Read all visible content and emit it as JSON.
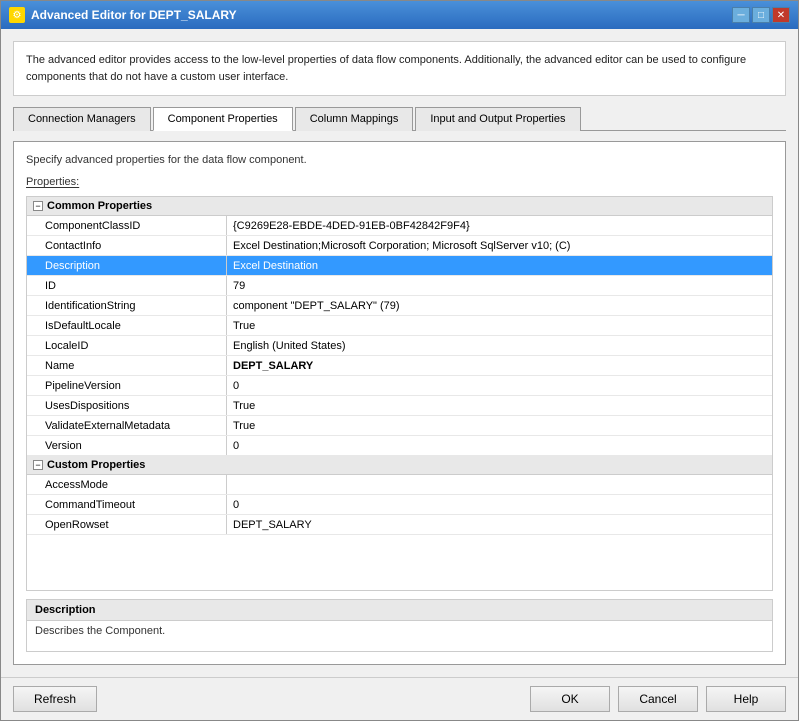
{
  "window": {
    "title": "Advanced Editor for DEPT_SALARY",
    "icon": "⚙"
  },
  "description": {
    "text": "The advanced editor provides access to the low-level properties of data flow components. Additionally, the advanced editor can be used to configure components that do not have a custom user interface."
  },
  "tabs": [
    {
      "id": "connection-managers",
      "label": "Connection Managers",
      "active": false
    },
    {
      "id": "component-properties",
      "label": "Component Properties",
      "active": true
    },
    {
      "id": "column-mappings",
      "label": "Column Mappings",
      "active": false
    },
    {
      "id": "input-output-properties",
      "label": "Input and Output Properties",
      "active": false
    }
  ],
  "panel": {
    "header": "Specify advanced properties for the data flow component.",
    "properties_label": "Properties:"
  },
  "sections": [
    {
      "id": "common",
      "title": "Common Properties",
      "expanded": true,
      "rows": [
        {
          "name": "ComponentClassID",
          "value": "{C9269E28-EBDE-4DED-91EB-0BF42842F9F4}",
          "selected": false,
          "bold": false
        },
        {
          "name": "ContactInfo",
          "value": "Excel Destination;Microsoft Corporation; Microsoft SqlServer v10; (C)",
          "selected": false,
          "bold": false
        },
        {
          "name": "Description",
          "value": "Excel Destination",
          "selected": true,
          "bold": false
        },
        {
          "name": "ID",
          "value": "79",
          "selected": false,
          "bold": false
        },
        {
          "name": "IdentificationString",
          "value": "component \"DEPT_SALARY\" (79)",
          "selected": false,
          "bold": false
        },
        {
          "name": "IsDefaultLocale",
          "value": "True",
          "selected": false,
          "bold": false
        },
        {
          "name": "LocaleID",
          "value": "English (United States)",
          "selected": false,
          "bold": false
        },
        {
          "name": "Name",
          "value": "DEPT_SALARY",
          "selected": false,
          "bold": true
        },
        {
          "name": "PipelineVersion",
          "value": "0",
          "selected": false,
          "bold": false
        },
        {
          "name": "UsesDispositions",
          "value": "True",
          "selected": false,
          "bold": false
        },
        {
          "name": "ValidateExternalMetadata",
          "value": "True",
          "selected": false,
          "bold": false
        },
        {
          "name": "Version",
          "value": "0",
          "selected": false,
          "bold": false
        }
      ]
    },
    {
      "id": "custom",
      "title": "Custom Properties",
      "expanded": true,
      "rows": [
        {
          "name": "AccessMode",
          "value": "",
          "selected": false,
          "bold": false
        },
        {
          "name": "CommandTimeout",
          "value": "0",
          "selected": false,
          "bold": false
        },
        {
          "name": "OpenRowset",
          "value": "DEPT_SALARY",
          "selected": false,
          "bold": false
        }
      ]
    }
  ],
  "description_footer": {
    "title": "Description",
    "text": "Describes the Component."
  },
  "buttons": {
    "refresh": "Refresh",
    "ok": "OK",
    "cancel": "Cancel",
    "help": "Help"
  }
}
